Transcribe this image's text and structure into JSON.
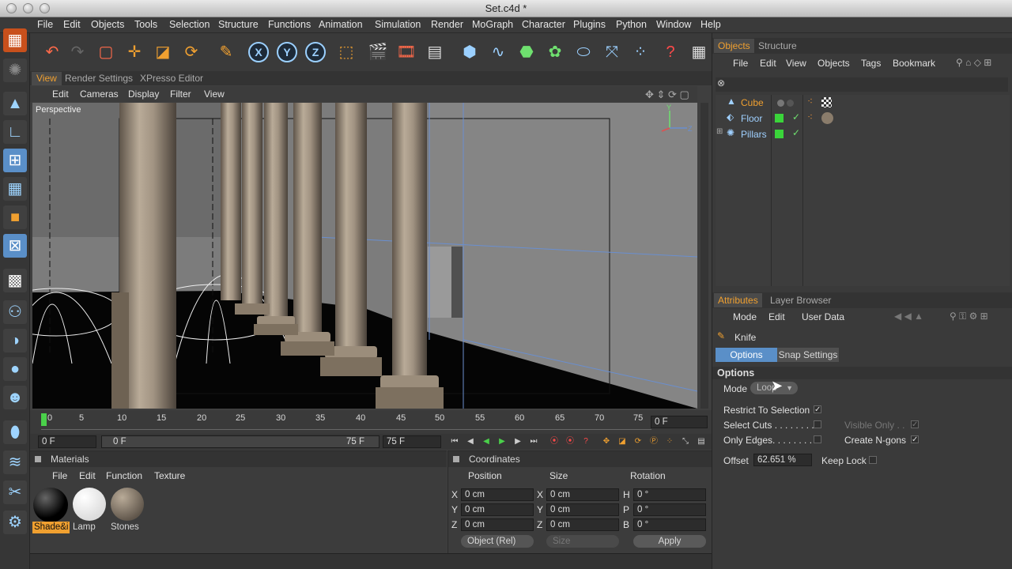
{
  "window": {
    "title": "Set.c4d *"
  },
  "menu": [
    "File",
    "Edit",
    "Objects",
    "Tools",
    "Selection",
    "Structure",
    "Functions",
    "Animation",
    "Simulation",
    "Render",
    "MoGraph",
    "Character",
    "Plugins",
    "Python",
    "Window",
    "Help"
  ],
  "view_tabs": [
    "View",
    "Render Settings",
    "XPresso Editor"
  ],
  "view_menu": [
    "Edit",
    "Cameras",
    "Display",
    "Filter",
    "View"
  ],
  "viewport": {
    "label": "Perspective",
    "axis_y": "Y",
    "axis_z": "Z"
  },
  "timeline": {
    "ticks": [
      "0",
      "5",
      "10",
      "15",
      "20",
      "25",
      "30",
      "35",
      "40",
      "45",
      "50",
      "55",
      "60",
      "65",
      "70",
      "75"
    ],
    "frame_field": "0 F",
    "current": "0 F",
    "range_start": "0 F",
    "range_end": "75 F",
    "end_field": "75 F"
  },
  "materials": {
    "title": "Materials",
    "menu": [
      "File",
      "Edit",
      "Function",
      "Texture"
    ],
    "items": [
      "Shade&i",
      "Lamp",
      "Stones"
    ]
  },
  "coordinates": {
    "title": "Coordinates",
    "headers": [
      "Position",
      "Size",
      "Rotation"
    ],
    "rows": [
      {
        "axis": "X",
        "pos": "0 cm",
        "size_axis": "X",
        "size": "0 cm",
        "rot_axis": "H",
        "rot": "0 °"
      },
      {
        "axis": "Y",
        "pos": "0 cm",
        "size_axis": "Y",
        "size": "0 cm",
        "rot_axis": "P",
        "rot": "0 °"
      },
      {
        "axis": "Z",
        "pos": "0 cm",
        "size_axis": "Z",
        "size": "0 cm",
        "rot_axis": "B",
        "rot": "0 °"
      }
    ],
    "mode": "Object (Rel)",
    "size_mode": "Size",
    "apply": "Apply"
  },
  "objects_panel": {
    "tabs": [
      "Objects",
      "Structure"
    ],
    "menu": [
      "File",
      "Edit",
      "View",
      "Objects",
      "Tags",
      "Bookmark"
    ],
    "items": [
      {
        "name": "Cube",
        "color": "#f0a030"
      },
      {
        "name": "Floor",
        "color": "#9fd0ff"
      },
      {
        "name": "Pillars",
        "color": "#9fd0ff"
      }
    ]
  },
  "attributes_panel": {
    "tabs": [
      "Attributes",
      "Layer Browser"
    ],
    "menu": [
      "Mode",
      "Edit",
      "User Data"
    ],
    "tool": "Knife",
    "subtabs": [
      "Options",
      "Snap Settings"
    ],
    "section": "Options",
    "mode_label": "Mode",
    "mode_value": "Loop",
    "restrict": "Restrict To Selection",
    "select_cuts": "Select Cuts . . . . . . . . .",
    "only_edges": "Only Edges. . . . . . . . .",
    "visible_only": "Visible Only . .",
    "create_ngons": "Create N-gons",
    "offset_label": "Offset",
    "offset_value": "62.651 %",
    "keep_lock": "Keep Lock"
  },
  "colors": {
    "accent": "#f0a030",
    "panel": "#3a3a3a",
    "viewport": "#808080",
    "highlight": "#5a8fc8"
  }
}
